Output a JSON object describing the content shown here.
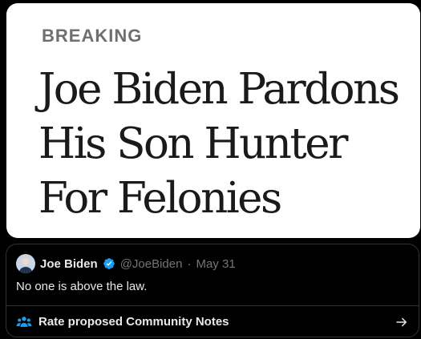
{
  "image": {
    "kicker": "BREAKING",
    "headline_lines": [
      "Joe Biden Pardons",
      "His Son Hunter",
      "For Felonies"
    ]
  },
  "quote": {
    "author_name": "Joe Biden",
    "handle": "@JoeBiden",
    "separator": "·",
    "date": "May 31",
    "text": "No one is above the law.",
    "verified_color": "#1d9bf0"
  },
  "community_notes": {
    "label": "Rate proposed Community Notes",
    "icon": "people-icon",
    "accent": "#1d9bf0"
  }
}
